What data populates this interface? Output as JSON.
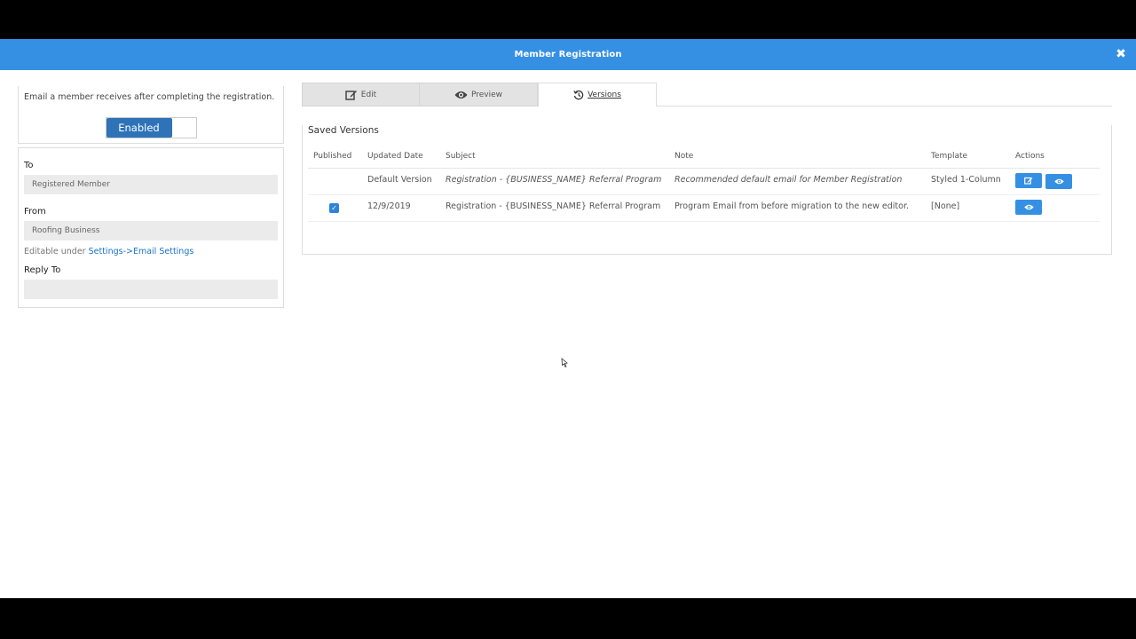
{
  "modal": {
    "title": "Member Registration"
  },
  "left": {
    "description": "Email a member receives after completing the registration.",
    "toggle_label": "Enabled",
    "to_label": "To",
    "to_value": "Registered Member",
    "from_label": "From",
    "from_value": "Roofing Business",
    "hint_prefix": "Editable under ",
    "hint_link": "Settings->Email Settings",
    "reply_to_label": "Reply To",
    "reply_to_value": ""
  },
  "tabs": {
    "edit": "Edit",
    "preview": "Preview",
    "versions": "Versions"
  },
  "versions": {
    "title": "Saved Versions",
    "columns": [
      "Published",
      "Updated Date",
      "Subject",
      "Note",
      "Template",
      "Actions"
    ],
    "rows": [
      {
        "published": false,
        "date": "Default Version",
        "subject": "Registration - {BUSINESS_NAME} Referral Program",
        "note": "Recommended default email for Member Registration",
        "template": "Styled 1-Column"
      },
      {
        "published": true,
        "date": "12/9/2019",
        "subject": "Registration - {BUSINESS_NAME} Referral Program",
        "note": "Program Email from before migration to the new editor.",
        "template": "[None]"
      }
    ]
  },
  "colors": {
    "header": "#3590e3",
    "toggle": "#2e73b8",
    "link": "#1a73c9"
  }
}
